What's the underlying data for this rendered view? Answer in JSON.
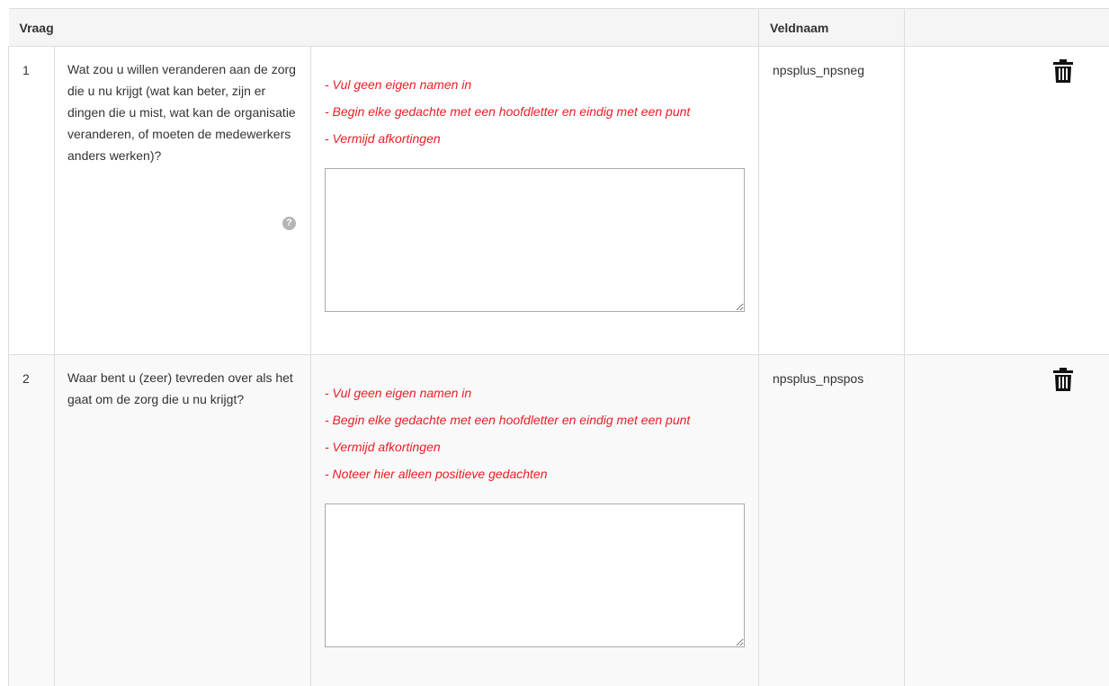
{
  "table": {
    "headers": {
      "question": "Vraag",
      "field_name": "Veldnaam",
      "actions": ""
    },
    "rows": [
      {
        "number": "1",
        "question": "Wat zou u willen veranderen aan de zorg die u nu krijgt (wat kan beter, zijn er dingen die u mist, wat kan de organisatie veranderen, of moeten de medewerkers anders werken)?",
        "has_help_icon": true,
        "hints": [
          "- Vul geen eigen namen in",
          "- Begin elke gedachte met een hoofdletter en eindig met een punt",
          "- Vermijd afkortingen"
        ],
        "answer_value": "",
        "field_name": "npsplus_npsneg",
        "delete_icon": "trash-icon"
      },
      {
        "number": "2",
        "question": "Waar bent u (zeer) tevreden over als het gaat om de zorg die u nu krijgt?",
        "has_help_icon": false,
        "hints": [
          "- Vul geen eigen namen in",
          "- Begin elke gedachte met een hoofdletter en eindig met een punt",
          "- Vermijd afkortingen",
          "- Noteer hier alleen positieve gedachten"
        ],
        "answer_value": "",
        "field_name": "npsplus_npspos",
        "delete_icon": "trash-icon"
      }
    ]
  },
  "colors": {
    "hint_text": "#ee1c24",
    "header_bg": "#f5f5f5",
    "striped_row_bg": "#f9f9f9",
    "border": "#dddddd"
  },
  "icons": {
    "help": "question-circle-icon",
    "delete": "trash-icon"
  }
}
